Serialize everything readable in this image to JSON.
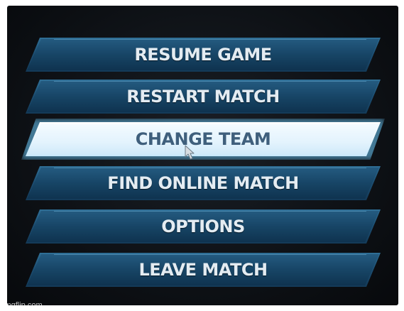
{
  "menu": {
    "items": [
      {
        "label": "RESUME GAME"
      },
      {
        "label": "RESTART MATCH"
      },
      {
        "label": "CHANGE TEAM"
      },
      {
        "label": "FIND ONLINE MATCH"
      },
      {
        "label": "OPTIONS"
      },
      {
        "label": "LEAVE MATCH"
      }
    ],
    "selected_label": "CHANGE TEAM"
  },
  "colors": {
    "button_fill": "#1d4f73",
    "button_highlight": "#2f6f96",
    "selected_fill": "#e8f6ff",
    "selected_glow": "#6ecdff",
    "label_text": "#e4ecf2",
    "selected_label_text": "#3f5f7c",
    "background": "#0c0f13"
  },
  "cursor": {
    "icon": "mouse-pointer-icon"
  },
  "watermark": {
    "text": "imgflip.com"
  }
}
